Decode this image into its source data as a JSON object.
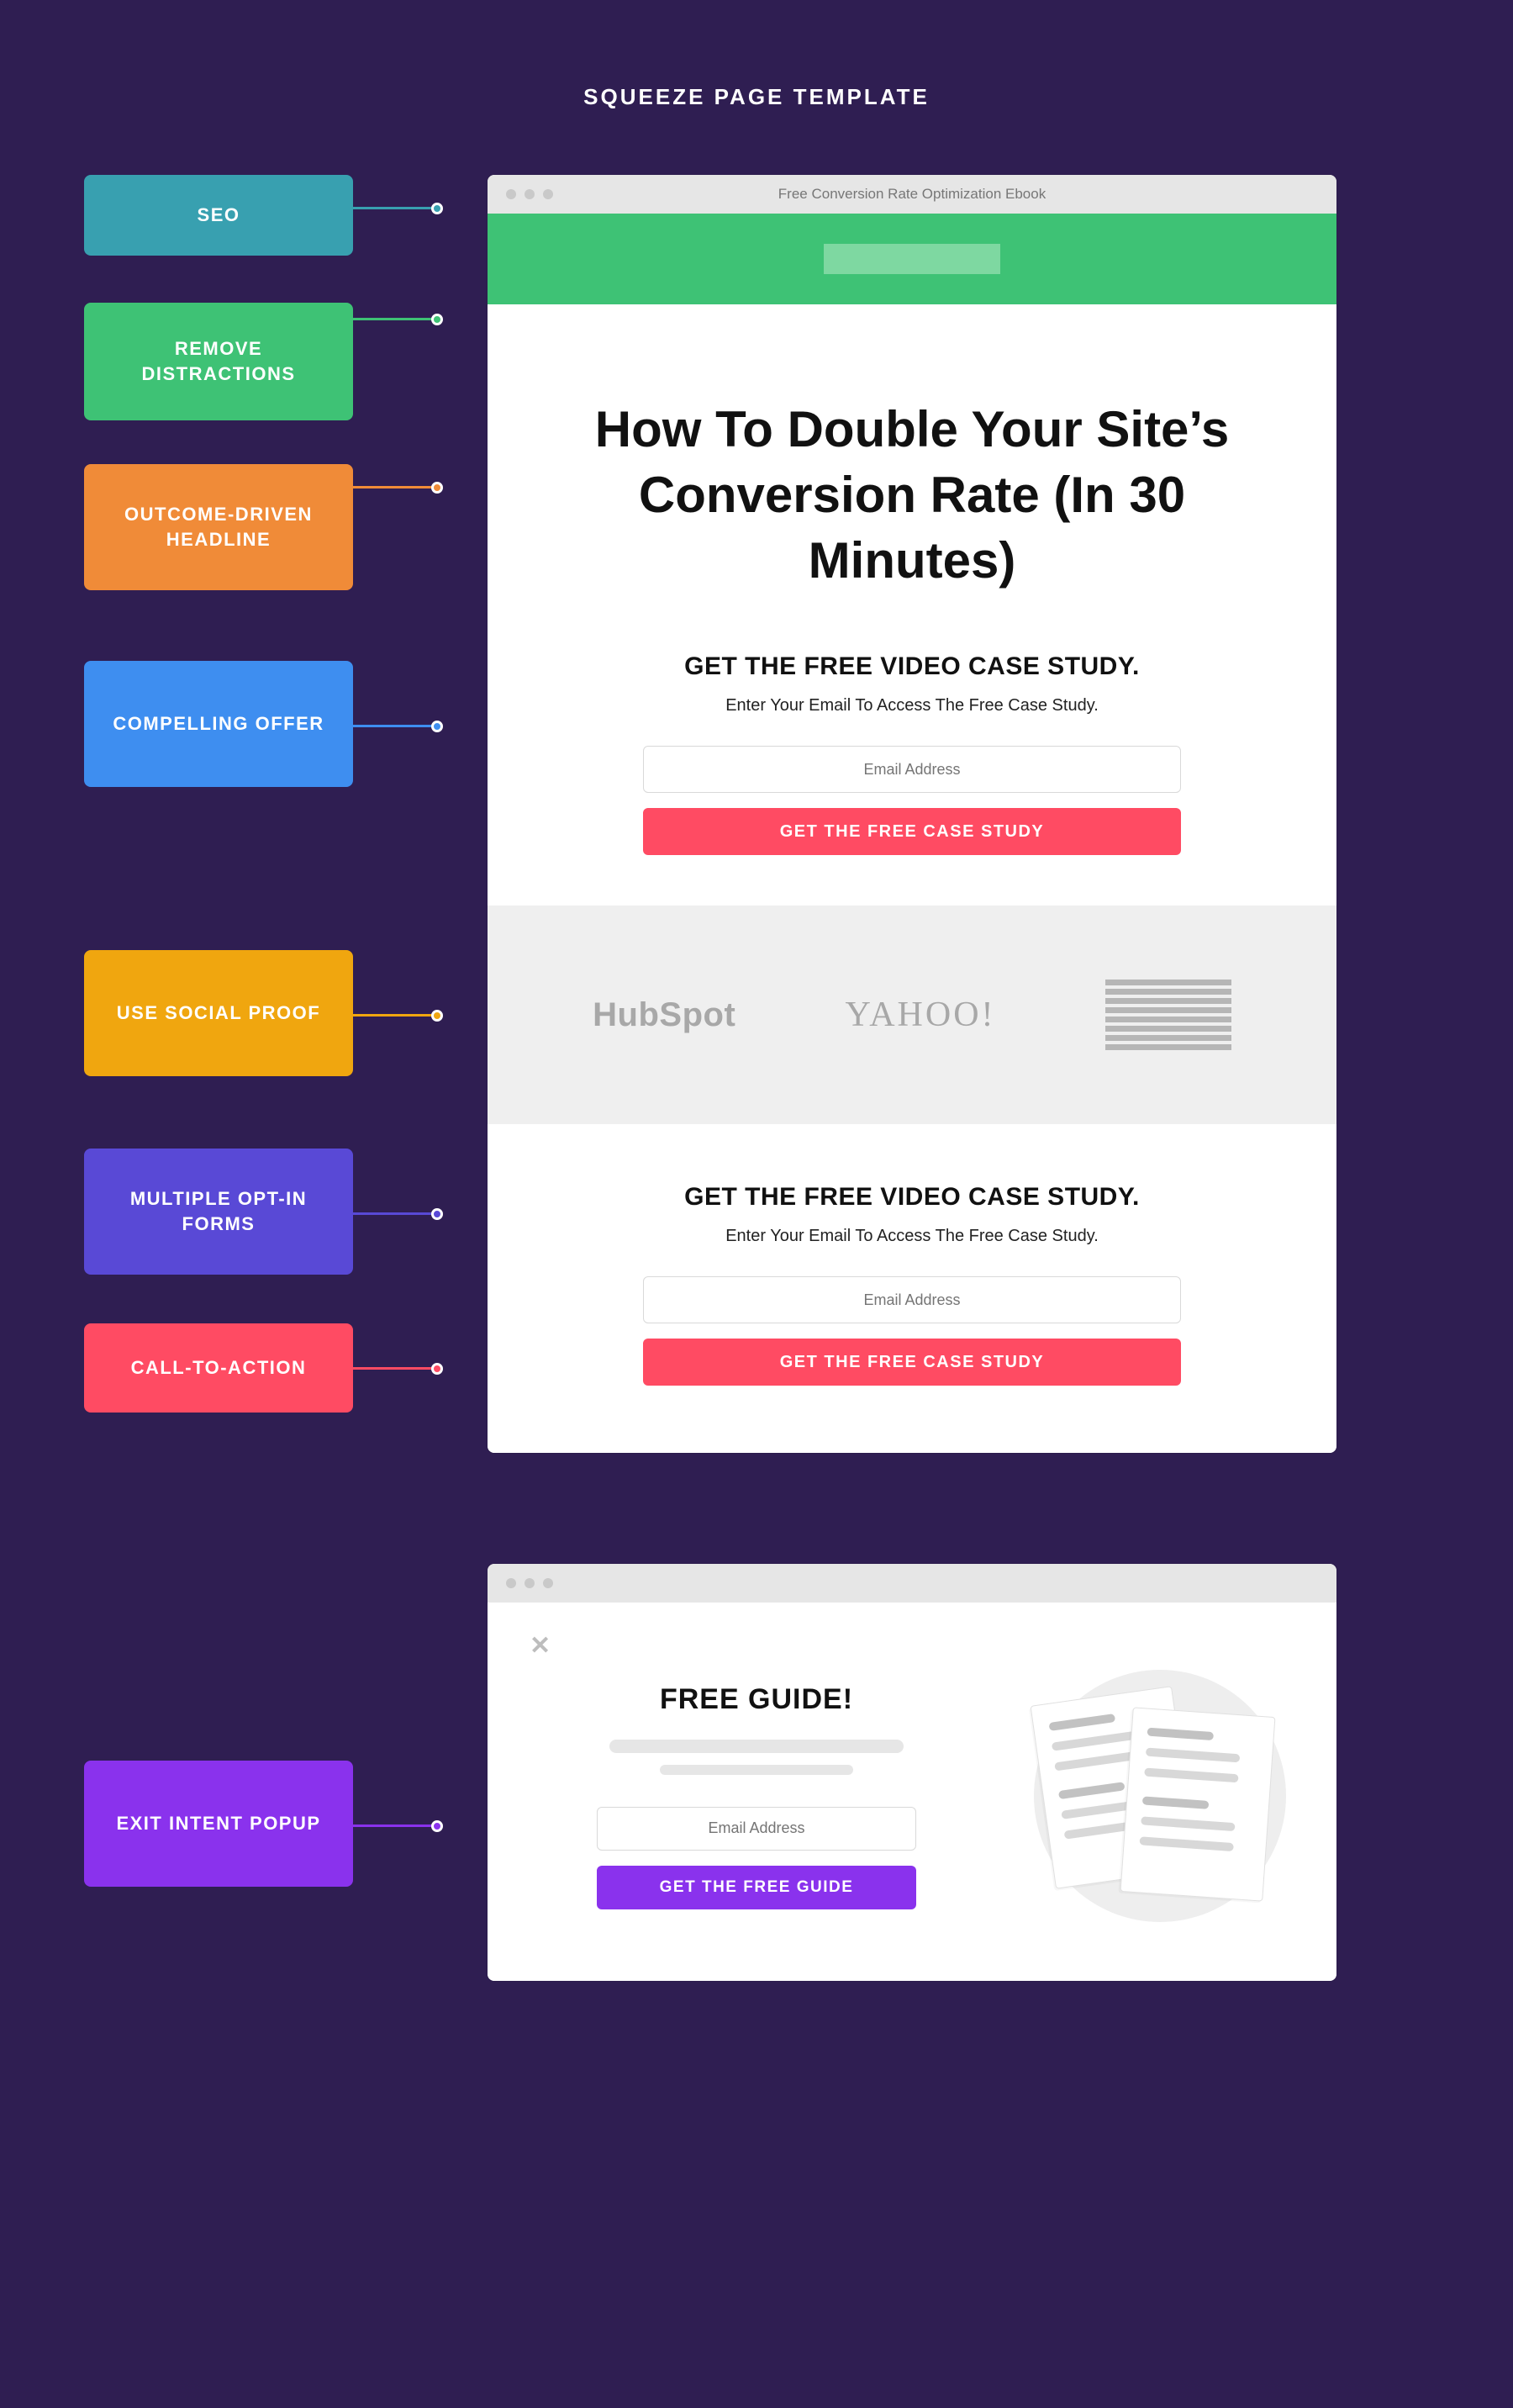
{
  "title": "SQUEEZE PAGE TEMPLATE",
  "annotations": {
    "seo": "SEO",
    "remove_distractions": "REMOVE DISTRACTIONS",
    "outcome_headline": "OUTCOME-DRIVEN HEADLINE",
    "compelling_offer": "COMPELLING OFFER",
    "social_proof": "USE SOCIAL PROOF",
    "multiple_optin": "MULTIPLE OPT-IN FORMS",
    "cta": "CALL-TO-ACTION",
    "exit_intent": "EXIT INTENT POPUP"
  },
  "colors": {
    "seo": "#38a0b0",
    "remove_distractions": "#3ec275",
    "outcome_headline": "#f08b38",
    "compelling_offer": "#3e8ef0",
    "social_proof": "#f0a60f",
    "multiple_optin": "#5949d6",
    "cta": "#ff4b63",
    "exit_intent": "#8a32ed"
  },
  "main_page": {
    "tab_title": "Free Conversion Rate Optimization Ebook",
    "headline": "How To Double Your Site’s Conversion Rate (In 30 Minutes)",
    "case_title": "GET THE FREE VIDEO CASE STUDY.",
    "case_sub": "Enter Your Email To Access The Free Case Study.",
    "email_placeholder": "Email Address",
    "cta_button": "GET THE FREE CASE STUDY",
    "logos": {
      "hubspot": "HubSpot",
      "yahoo": "YAHOO!",
      "ibm": "IBM"
    }
  },
  "popup": {
    "headline": "FREE GUIDE!",
    "email_placeholder": "Email Address",
    "cta_button": "GET THE FREE GUIDE"
  }
}
